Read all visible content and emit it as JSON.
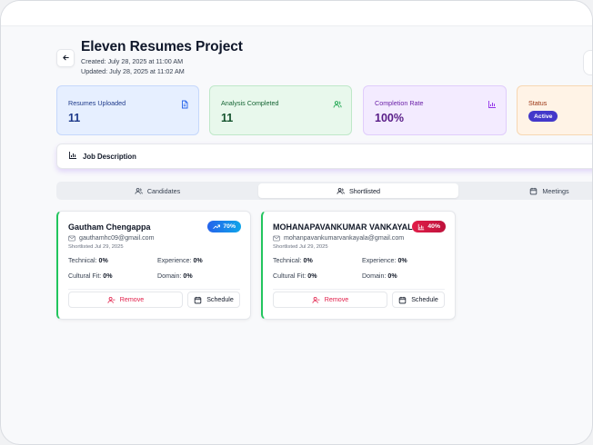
{
  "project": {
    "title": "Eleven Resumes Project",
    "created": "Created: July 28, 2025 at 11:00 AM",
    "updated": "Updated: July 28, 2025 at 11:02 AM"
  },
  "stats": [
    {
      "label": "Resumes Uploaded",
      "value": "11",
      "icon": "document-icon"
    },
    {
      "label": "Analysis Completed",
      "value": "11",
      "icon": "users-icon"
    },
    {
      "label": "Completion Rate",
      "value": "100%",
      "icon": "bar-chart-icon"
    },
    {
      "label": "Status",
      "value": "Active"
    }
  ],
  "job_description": {
    "label": "Job Description",
    "icon": "bar-chart-icon"
  },
  "tabs": [
    {
      "label": "Candidates",
      "icon": "users-icon"
    },
    {
      "label": "Shortlisted",
      "icon": "users-icon",
      "active": true
    },
    {
      "label": "Meetings",
      "icon": "calendar-icon"
    }
  ],
  "candidates": [
    {
      "name": "Gautham Chengappa",
      "email": "gauthamhc09@gmail.com",
      "shortlisted": "Shortlisted Jul 29, 2025",
      "score": "70%",
      "score_icon": "trending-up-icon",
      "technical_label": "Technical:",
      "technical": "0%",
      "experience_label": "Experience:",
      "experience": "0%",
      "cultural_label": "Cultural Fit:",
      "cultural": "0%",
      "domain_label": "Domain:",
      "domain": "0%",
      "remove_label": "Remove",
      "schedule_label": "Schedule"
    },
    {
      "name": "MOHANAPAVANKUMAR VANKAYALA",
      "email": "mohanpavankumarvankayala@gmail.com",
      "shortlisted": "Shortlisted Jul 29, 2025",
      "score": "40%",
      "score_icon": "bar-chart-icon",
      "technical_label": "Technical:",
      "technical": "0%",
      "experience_label": "Experience:",
      "experience": "0%",
      "cultural_label": "Cultural Fit:",
      "cultural": "0%",
      "domain_label": "Domain:",
      "domain": "0%",
      "remove_label": "Remove",
      "schedule_label": "Schedule"
    }
  ],
  "colors": {
    "accent_green": "#22c55e",
    "status_active": "#4338ca",
    "remove_red": "#e11d48",
    "score_high": "#2563eb",
    "score_low": "#e11d48"
  }
}
